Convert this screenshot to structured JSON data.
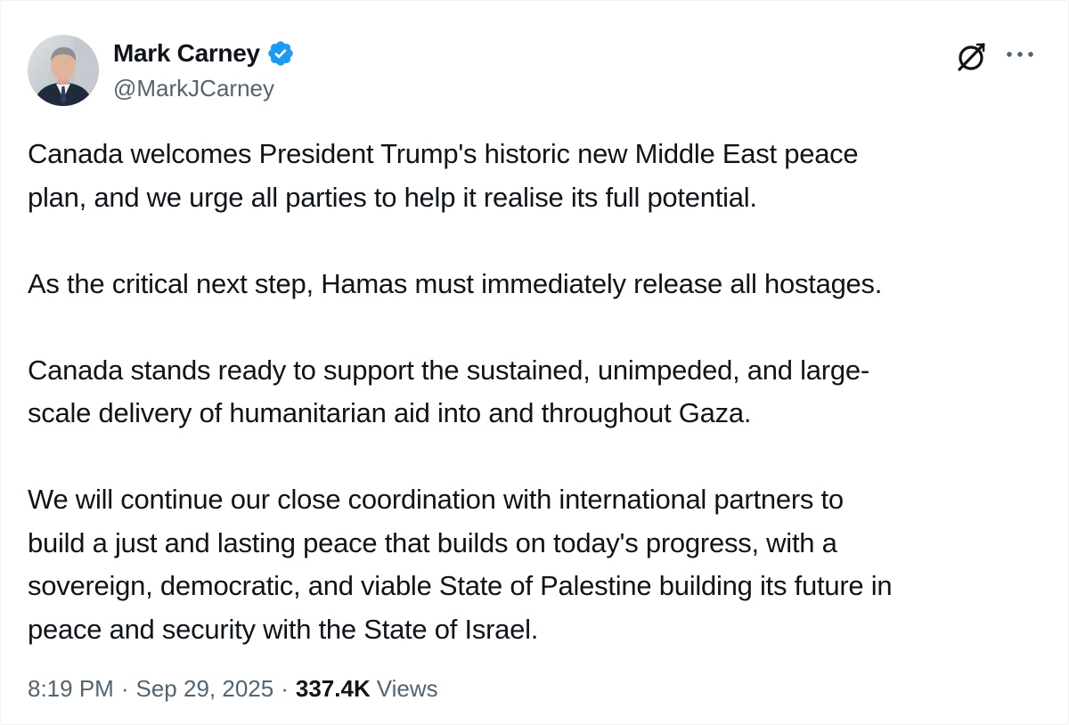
{
  "author": {
    "display_name": "Mark Carney",
    "handle": "@MarkJCarney",
    "verified": true
  },
  "icons": {
    "verified": "verified-badge-icon",
    "grok": "grok-icon",
    "more": "more-horizontal-icon"
  },
  "colors": {
    "verified_blue": "#1d9bf0",
    "text_primary": "#0f1419",
    "text_secondary": "#536471"
  },
  "tweet": {
    "paragraphs": [
      "Canada welcomes President Trump's historic new Middle East peace\nplan, and we urge all parties to help it realise its full potential.",
      "As the critical next step, Hamas must immediately release all hostages.",
      "Canada stands ready to support the sustained, unimpeded, and large-\nscale delivery of humanitarian aid into and throughout Gaza.",
      "We will continue our close coordination with international partners to\nbuild a just and lasting peace that builds on today's progress, with a\nsovereign, democratic, and viable State of Palestine building its future in\npeace and security with the State of Israel."
    ],
    "time": "8:19 PM",
    "separator": "·",
    "date": "Sep 29, 2025",
    "views_count": "337.4K",
    "views_label": "Views"
  }
}
